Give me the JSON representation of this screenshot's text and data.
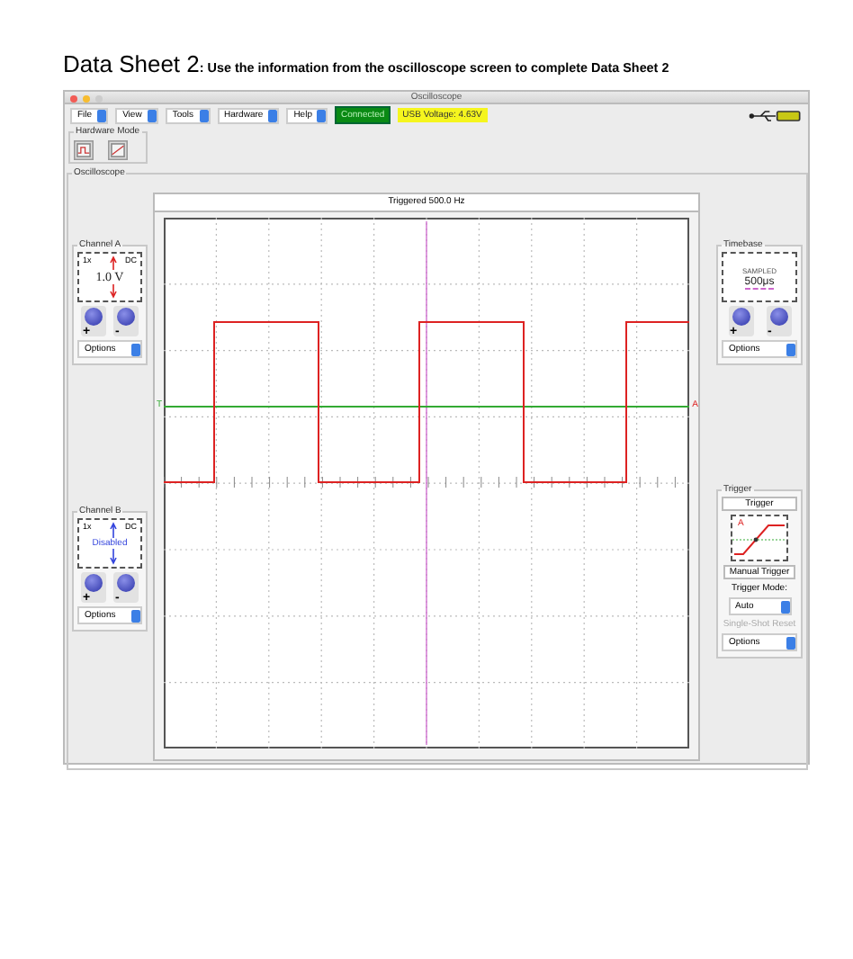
{
  "heading": {
    "title": "Data Sheet 2",
    "instruction": ": Use the information from the oscilloscope screen to complete Data Sheet 2"
  },
  "window": {
    "title": "Oscilloscope"
  },
  "menus": [
    {
      "label": "File"
    },
    {
      "label": "View"
    },
    {
      "label": "Tools"
    },
    {
      "label": "Hardware"
    },
    {
      "label": "Help"
    }
  ],
  "status": {
    "connection": "Connected",
    "voltage": "USB Voltage: 4.63V"
  },
  "hardware_mode": {
    "title": "Hardware Mode"
  },
  "oscilloscope": {
    "title": "Oscilloscope",
    "display_title": "Triggered 500.0 Hz",
    "trigger_marker": "T",
    "channel_marker": "A",
    "channels": [
      {
        "title": "Channel A",
        "probe": "1x",
        "coupling": "DC",
        "scale": "1.0 V",
        "disabled": false,
        "plus": "+",
        "minus": "-",
        "options": "Options"
      },
      {
        "title": "Channel B",
        "probe": "1x",
        "coupling": "DC",
        "scale": "Disabled",
        "disabled": true,
        "plus": "+",
        "minus": "-",
        "options": "Options"
      }
    ],
    "timebase": {
      "title": "Timebase",
      "mode": "SAMPLED",
      "scale": "500μs",
      "plus": "+",
      "minus": "-",
      "options": "Options"
    },
    "trigger": {
      "title": "Trigger",
      "button": "Trigger",
      "channel": "A",
      "manual": "Manual Trigger",
      "mode_label": "Trigger Mode:",
      "mode": "Auto",
      "reset": "Single-Shot Reset",
      "reset_disabled": true,
      "options": "Options"
    }
  }
}
